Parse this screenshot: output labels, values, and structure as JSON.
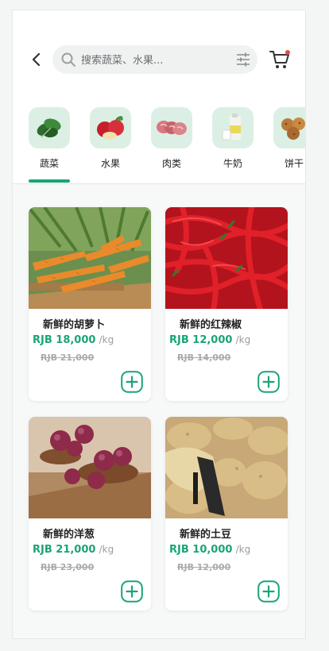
{
  "header": {
    "search_placeholder": "搜索蔬菜、水果..."
  },
  "categories": [
    {
      "label": "蔬菜",
      "icon": "spinach-icon",
      "active": true
    },
    {
      "label": "水果",
      "icon": "apples-icon"
    },
    {
      "label": "肉类",
      "icon": "meat-icon"
    },
    {
      "label": "牛奶",
      "icon": "milk-icon"
    },
    {
      "label": "饼干",
      "icon": "biscuit-icon"
    }
  ],
  "products": [
    {
      "name": "新鲜的胡萝卜",
      "price": "RJB 18,000",
      "unit": "/kg",
      "old_price": "RJB 21,000",
      "image": "carrots"
    },
    {
      "name": "新鲜的红辣椒",
      "price": "RJB 12,000",
      "unit": "/kg",
      "old_price": "RJB 14,000",
      "image": "red-chili"
    },
    {
      "name": "新鲜的洋葱",
      "price": "RJB 21,000",
      "unit": "/kg",
      "old_price": "RJB 23,000",
      "image": "onions"
    },
    {
      "name": "新鲜的土豆",
      "price": "RJB 10,000",
      "unit": "/kg",
      "old_price": "RJB 12,000",
      "image": "potatoes"
    }
  ],
  "colors": {
    "accent": "#1aa478",
    "category_tile": "#dcefe5",
    "badge": "#e24b4b"
  }
}
